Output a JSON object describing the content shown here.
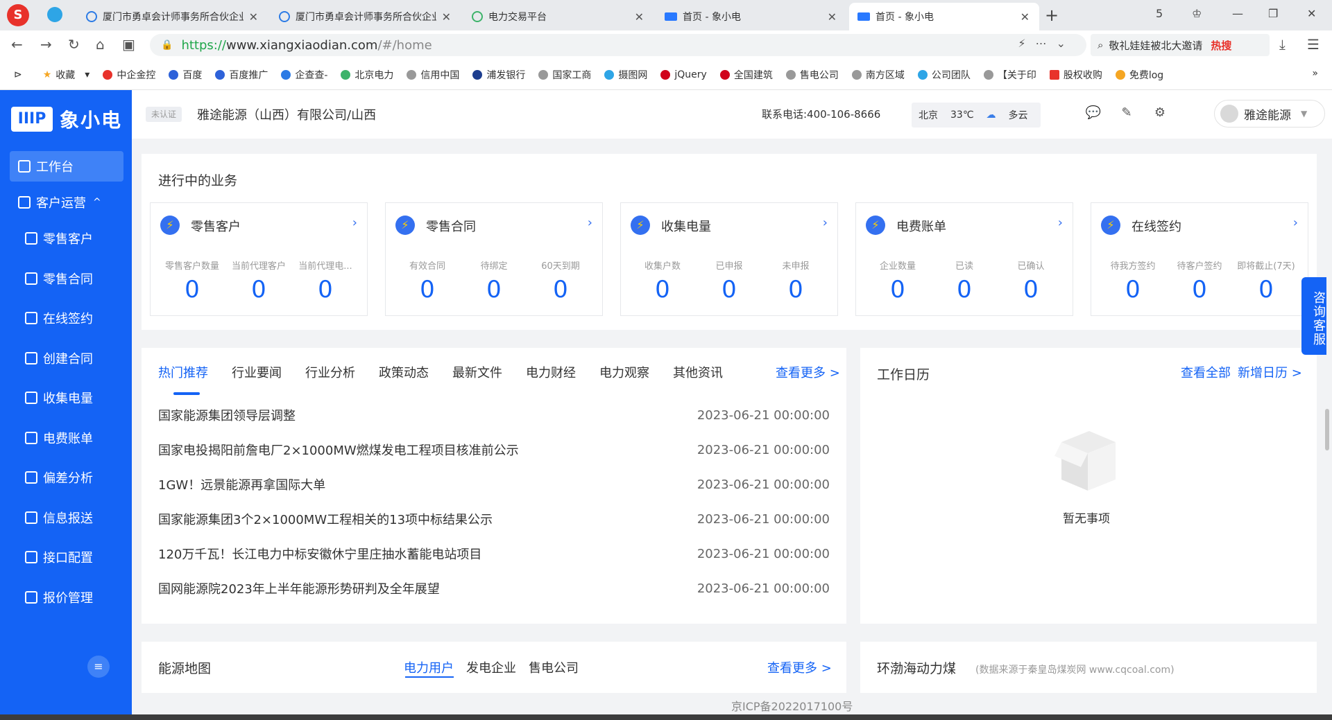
{
  "browser": {
    "tabs": [
      {
        "label": "厦门市勇卓会计师事务所合伙企业",
        "icon": "qcc-icon"
      },
      {
        "label": "厦门市勇卓会计师事务所合伙企业",
        "icon": "qcc-icon"
      },
      {
        "label": "电力交易平台",
        "icon": "power-icon"
      },
      {
        "label": "首页 - 象小电",
        "icon": "xxd-icon"
      },
      {
        "label": "首页 - 象小电",
        "icon": "xxd-icon"
      }
    ],
    "tab_count": "5",
    "url_protocol": "https://",
    "url_host": "www.xiangxiaodian.com",
    "url_path": "/#/home",
    "search_text": "敬礼娃娃被北大邀请",
    "search_hot": "热搜",
    "bookmarks": [
      "收藏",
      "中企金控",
      "百度",
      "百度推广",
      "企查查-",
      "北京电力",
      "信用中国",
      "浦发银行",
      "国家工商",
      "摄图网",
      "jQuery",
      "全国建筑",
      "售电公司",
      "南方区域",
      "公司团队",
      "【关于印",
      "股权收购",
      "免费log"
    ]
  },
  "sidebar": {
    "brand": "象小电",
    "brand_mark": "IIIP",
    "items": [
      {
        "label": "工作台",
        "icon": "grid-icon"
      },
      {
        "label": "客户运营",
        "icon": "cube-icon",
        "caret": "^"
      },
      {
        "label": "零售客户",
        "icon": "user-icon"
      },
      {
        "label": "零售合同",
        "icon": "contract-icon"
      },
      {
        "label": "在线签约",
        "icon": "sign-icon"
      },
      {
        "label": "创建合同",
        "icon": "create-icon"
      },
      {
        "label": "收集电量",
        "icon": "collect-icon"
      },
      {
        "label": "电费账单",
        "icon": "bill-icon"
      },
      {
        "label": "偏差分析",
        "icon": "chart-icon"
      },
      {
        "label": "信息报送",
        "icon": "report-icon"
      },
      {
        "label": "接口配置",
        "icon": "config-icon"
      },
      {
        "label": "报价管理",
        "icon": "quote-icon"
      }
    ]
  },
  "header": {
    "badge": "未认证",
    "company": "雅途能源（山西）有限公司/山西",
    "phone": "联系电话:400-106-8666",
    "weather": {
      "city": "北京",
      "temp": "33℃",
      "desc": "多云"
    },
    "user": "雅途能源"
  },
  "business": {
    "title": "进行中的业务",
    "cards": [
      {
        "title": "零售客户",
        "stats": [
          {
            "label": "零售客户数量",
            "value": "0"
          },
          {
            "label": "当前代理客户",
            "value": "0"
          },
          {
            "label": "当前代理电...",
            "value": "0"
          }
        ]
      },
      {
        "title": "零售合同",
        "stats": [
          {
            "label": "有效合同",
            "value": "0"
          },
          {
            "label": "待绑定",
            "value": "0"
          },
          {
            "label": "60天到期",
            "value": "0"
          }
        ]
      },
      {
        "title": "收集电量",
        "stats": [
          {
            "label": "收集户数",
            "value": "0"
          },
          {
            "label": "已申报",
            "value": "0"
          },
          {
            "label": "未申报",
            "value": "0"
          }
        ]
      },
      {
        "title": "电费账单",
        "stats": [
          {
            "label": "企业数量",
            "value": "0"
          },
          {
            "label": "已读",
            "value": "0"
          },
          {
            "label": "已确认",
            "value": "0"
          }
        ]
      },
      {
        "title": "在线签约",
        "stats": [
          {
            "label": "待我方签约",
            "value": "0"
          },
          {
            "label": "待客户签约",
            "value": "0"
          },
          {
            "label": "即将截止(7天)",
            "value": "0"
          }
        ]
      }
    ]
  },
  "news": {
    "tabs": [
      "热门推荐",
      "行业要闻",
      "行业分析",
      "政策动态",
      "最新文件",
      "电力财经",
      "电力观察",
      "其他资讯"
    ],
    "more": "查看更多 >",
    "items": [
      {
        "title": "国家能源集团领导层调整",
        "date": "2023-06-21 00:00:00"
      },
      {
        "title": "国家电投揭阳前詹电厂2×1000MW燃煤发电工程项目核准前公示",
        "date": "2023-06-21 00:00:00"
      },
      {
        "title": "1GW！远景能源再拿国际大单",
        "date": "2023-06-21 00:00:00"
      },
      {
        "title": "国家能源集团3个2×1000MW工程相关的13项中标结果公示",
        "date": "2023-06-21 00:00:00"
      },
      {
        "title": "120万千瓦！长江电力中标安徽休宁里庄抽水蓄能电站项目",
        "date": "2023-06-21 00:00:00"
      },
      {
        "title": "国网能源院2023年上半年能源形势研判及全年展望",
        "date": "2023-06-21 00:00:00"
      }
    ]
  },
  "calendar": {
    "title": "工作日历",
    "view_all": "查看全部",
    "add": "新增日历 >",
    "empty": "暂无事项"
  },
  "energy_map": {
    "title": "能源地图",
    "tabs": [
      "电力用户",
      "发电企业",
      "售电公司"
    ],
    "more": "查看更多 >"
  },
  "coal": {
    "title": "环渤海动力煤",
    "source": "(数据来源于秦皇岛煤炭网 www.cqcoal.com)"
  },
  "footer": {
    "icp": "京ICP备2022017100号"
  },
  "consult": "咨询客服"
}
